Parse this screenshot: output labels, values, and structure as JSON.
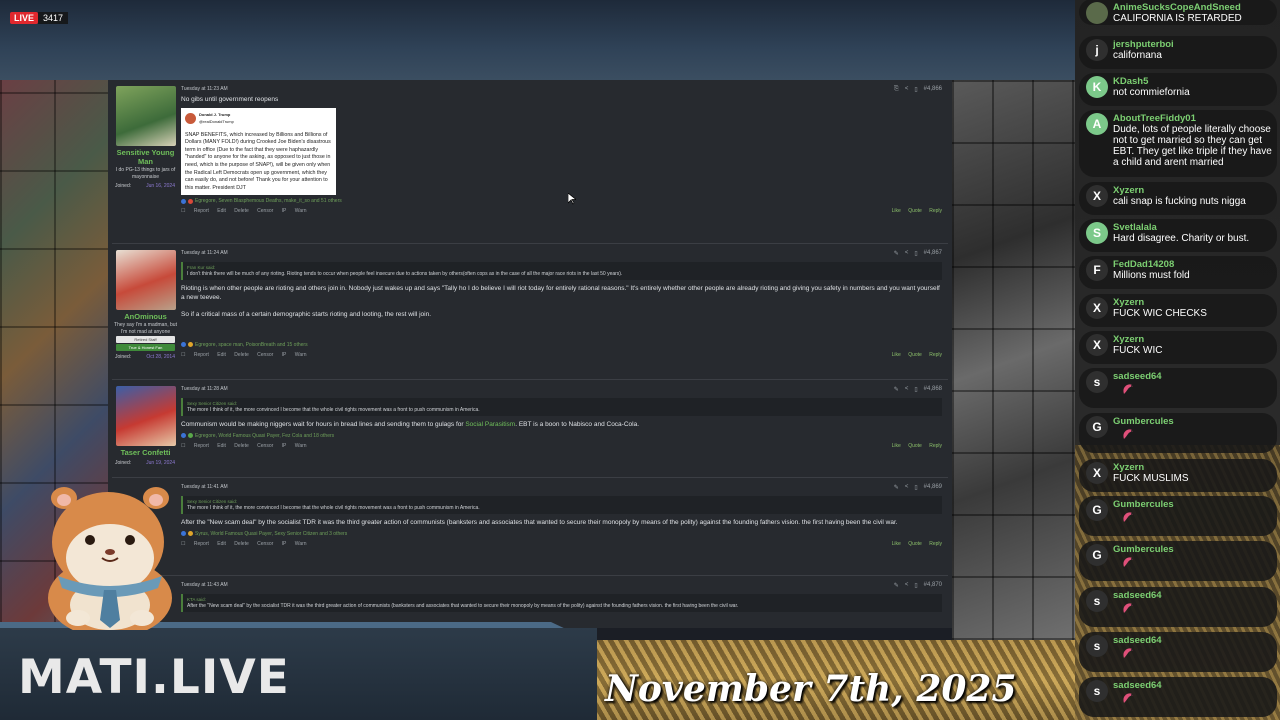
{
  "stream": {
    "live_label": "LIVE",
    "viewer_count": "3417",
    "logo": "MATI.LIVE",
    "date": "November 7th, 2025"
  },
  "posts": [
    {
      "username": "Sensitive Young Man",
      "user_title": "I do PG-13 things to jars of mayonnaise",
      "joined_label": "Joined:",
      "joined_date": "Jun 16, 2024",
      "timestamp": "Tuesday at 11:23 AM",
      "post_number": "#4,866",
      "text": "No gibs until government reopens",
      "tweet": {
        "author": "Donald J. Trump",
        "handle": "@realDonaldTrump",
        "text": "SNAP BENEFITS, which increased by Billions and Billions of Dollars (MANY FOLD!) during Crooked Joe Biden's disastrous term in office (Due to the fact that they were haphazardly \"handed\" to anyone for the asking, as opposed to just those in need, which is the purpose of SNAP!), will be given only when the Radical Left Democrats open up government, which they can easily do, and not before! Thank you for your attention to this matter. President DJT"
      },
      "reactions": "Egregore, Seven Blasphemous Deaths, make_it_so and 51 others"
    },
    {
      "username": "AnOminous",
      "user_title": "They say I'm a madman, but I'm not mad at anyone",
      "badges": [
        "Retired Staff",
        "True & Honest Fan"
      ],
      "joined_label": "Joined:",
      "joined_date": "Oct 28, 2014",
      "timestamp": "Tuesday at 11:24 AM",
      "post_number": "#4,867",
      "quote_author": "Fran Kur said:",
      "quote": "I don't think there will be much of any rioting. Rioting tends to occur when people feel insecure due to actions taken by others(often cops as in the case of all the major race riots in the last 50 years).",
      "text1": "Rioting is when other people are rioting and others join in. Nobody just wakes up and says \"Tally ho I do believe I will riot today for entirely rational reasons.\" It's entirely whether other people are already rioting and giving you safety in numbers and you want yourself a new teevee.",
      "text2": "So if a critical mass of a certain demographic starts rioting and looting, the rest will join.",
      "reactions": "Egregore, space man, PoisonBreath and 15 others"
    },
    {
      "username": "Taser Confetti",
      "joined_label": "Joined:",
      "joined_date": "Jun 19, 2024",
      "timestamp": "Tuesday at 11:28 AM",
      "post_number": "#4,868",
      "quote_author": "Sexy Senior Citizen said:",
      "quote": "The more I think of it, the more convinced I become that the whole civil rights movement was a front to push communism in America.",
      "text_a": "Communism would be making niggers wait for hours in bread lines and sending them to gulags for ",
      "text_link": "Social Parasitism",
      "text_b": ". EBT is a boon to Nabisco and Coca-Cola.",
      "reactions": "Egregore, World Famous Quasi Payer, Fez Cola and 18 others"
    },
    {
      "timestamp": "Tuesday at 11:41 AM",
      "post_number": "#4,869",
      "quote_author": "Sexy Senior Citizen said:",
      "quote": "The more I think of it, the more convinced I become that the whole civil rights movement was a front to push communism in America.",
      "text": "After the \"New scam deal\" by the socialist TDR it was the third greater action of communists (banksters and associates that wanted to secure their monopoly by means of the polity) against the founding fathers vision. the first having been the civil war.",
      "reactions": "Syrus, World Famous Quasi Payer, Sexy Senior Citizen and 3 others"
    },
    {
      "timestamp": "Tuesday at 11:43 AM",
      "post_number": "#4,870",
      "quote_author": "KTA said:",
      "quote": "After the \"New scam deal\" by the socialist TDR it was the third greater action of communists (banksters and associates that wanted to secure their monopoly by means of the polity) against the founding fathers vision. the first having been the civil war."
    }
  ],
  "post_actions": [
    "Report",
    "Edit",
    "Delete",
    "Censor",
    "IP",
    "Warn"
  ],
  "post_actions_right": [
    "Like",
    "Quote",
    "Reply"
  ],
  "chat": [
    {
      "name": "AnimeSucksCopeAndSneed",
      "text": "CALIFORNIA IS RETARDED",
      "initial": "",
      "color": "#5a6a4a"
    },
    {
      "name": "jershputerboi",
      "text": "californana",
      "initial": "j",
      "color": "#2f2f2f"
    },
    {
      "name": "KDash5",
      "text": "not commiefornia",
      "initial": "K",
      "color": "#7cc98a"
    },
    {
      "name": "AboutTreeFiddy01",
      "text": "Dude, lots of people literally choose not to get married so they can get EBT. They get like triple if they have a child and arent married",
      "initial": "A",
      "color": "#7cc98a"
    },
    {
      "name": "Xyzern",
      "text": "cali snap is fucking nuts nigga",
      "initial": "X",
      "color": "#2f2f2f"
    },
    {
      "name": "Svetlalala",
      "text": "Hard disagree. Charity or bust.",
      "initial": "S",
      "color": "#7cc98a"
    },
    {
      "name": "FedDad14208",
      "text": "Millions must fold",
      "initial": "F",
      "color": "#2f2f2f"
    },
    {
      "name": "Xyzern",
      "text": "FUCK WIC CHECKS",
      "initial": "X",
      "color": "#2f2f2f"
    },
    {
      "name": "Xyzern",
      "text": "FUCK WIC",
      "initial": "X",
      "color": "#2f2f2f"
    },
    {
      "name": "sadseed64",
      "text": "",
      "initial": "s",
      "color": "#2f2f2f"
    },
    {
      "name": "Gumbercules",
      "text": "",
      "initial": "G",
      "color": "#2f2f2f"
    },
    {
      "name": "Xyzern",
      "text": "FUCK MUSLIMS",
      "initial": "X",
      "color": "#2f2f2f"
    },
    {
      "name": "Gumbercules",
      "text": "",
      "initial": "G",
      "color": "#2f2f2f"
    },
    {
      "name": "Gumbercules",
      "text": "",
      "initial": "G",
      "color": "#2f2f2f"
    },
    {
      "name": "sadseed64",
      "text": "",
      "initial": "s",
      "color": "#2f2f2f"
    },
    {
      "name": "sadseed64",
      "text": "",
      "initial": "s",
      "color": "#2f2f2f"
    },
    {
      "name": "sadseed64",
      "text": "",
      "initial": "s",
      "color": "#2f2f2f"
    }
  ],
  "colors": {
    "username_green": "#6fbf5a",
    "chat_name_green": "#7ccf72",
    "live_red": "#e0282e",
    "emote_pink": "#e0507a"
  }
}
